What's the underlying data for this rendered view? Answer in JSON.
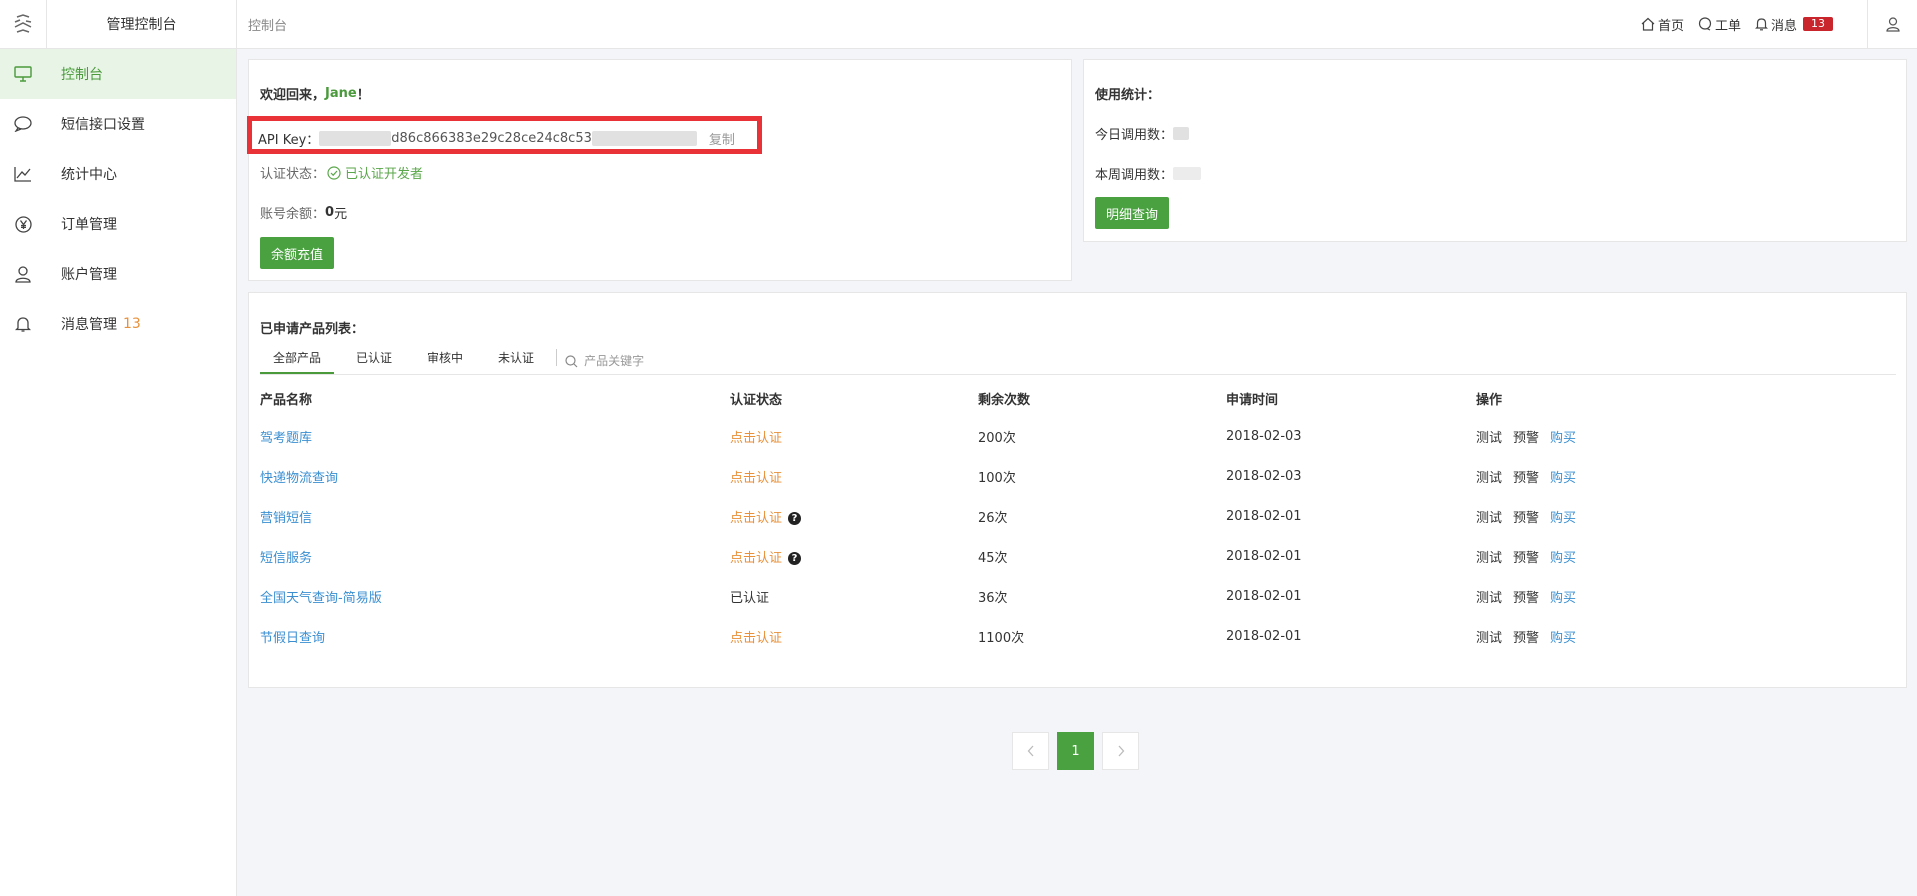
{
  "app": {
    "title": "管理控制台"
  },
  "breadcrumb": "控制台",
  "header": {
    "home": "首页",
    "ticket": "工单",
    "messages": "消息",
    "messages_count": "13"
  },
  "sidebar": {
    "items": [
      {
        "label": "控制台",
        "icon": "monitor-icon",
        "active": true
      },
      {
        "label": "短信接口设置",
        "icon": "chat-bubble-icon"
      },
      {
        "label": "统计中心",
        "icon": "line-chart-icon"
      },
      {
        "label": "订单管理",
        "icon": "yen-icon"
      },
      {
        "label": "账户管理",
        "icon": "user-icon"
      },
      {
        "label": "消息管理",
        "icon": "bell-icon",
        "badge": "13"
      }
    ]
  },
  "welcome": {
    "prefix": "欢迎回来，",
    "name": "Jane",
    "suffix": "！",
    "api_label": "API Key：",
    "api_key_visible": "d86c866383e29c28ce24c8c53",
    "copy": "复制",
    "auth_label": "认证状态：",
    "auth_value": "已认证开发者",
    "balance_label": "账号余额：",
    "balance_value": "0",
    "balance_unit": "元",
    "recharge": "余额充值"
  },
  "stats": {
    "title": "使用统计：",
    "today_label": "今日调用数：",
    "week_label": "本周调用数：",
    "detail_button": "明细查询"
  },
  "products": {
    "title": "已申请产品列表：",
    "tabs": [
      "全部产品",
      "已认证",
      "审核中",
      "未认证"
    ],
    "search_placeholder": "产品关键字",
    "columns": [
      "产品名称",
      "认证状态",
      "剩余次数",
      "申请时间",
      "操作"
    ],
    "ops": {
      "test": "测试",
      "warn": "预警",
      "buy": "购买"
    },
    "rows": [
      {
        "name": "驾考题库",
        "status": "点击认证",
        "status_type": "link",
        "remaining": "200次",
        "date": "2018-02-03"
      },
      {
        "name": "快递物流查询",
        "status": "点击认证",
        "status_type": "link",
        "remaining": "100次",
        "date": "2018-02-03"
      },
      {
        "name": "营销短信",
        "status": "点击认证",
        "status_type": "link",
        "help": true,
        "remaining": "26次",
        "date": "2018-02-01"
      },
      {
        "name": "短信服务",
        "status": "点击认证",
        "status_type": "link",
        "help": true,
        "remaining": "45次",
        "date": "2018-02-01"
      },
      {
        "name": "全国天气查询-简易版",
        "status": "已认证",
        "status_type": "text",
        "remaining": "36次",
        "date": "2018-02-01"
      },
      {
        "name": "节假日查询",
        "status": "点击认证",
        "status_type": "link",
        "remaining": "1100次",
        "date": "2018-02-01"
      }
    ]
  },
  "pagination": {
    "current": "1"
  },
  "colors": {
    "accent": "#4aa140",
    "link": "#3b8fd1",
    "warning": "#e8913a",
    "highlight_box": "#e83237",
    "badge": "#c9252c"
  }
}
